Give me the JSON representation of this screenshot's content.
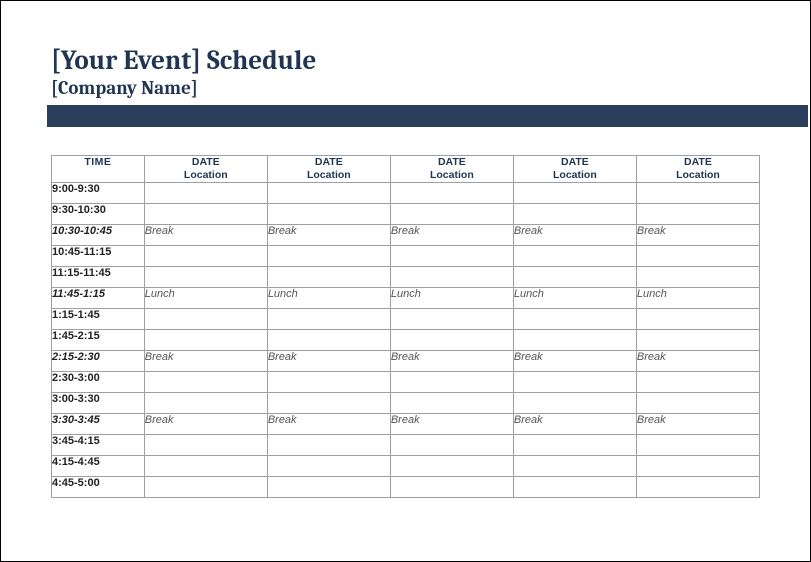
{
  "header": {
    "title": "[Your Event] Schedule",
    "subtitle": "[Company Name]"
  },
  "table": {
    "time_heading": "TIME",
    "column_header": {
      "date": "DATE",
      "location": "Location"
    },
    "columns": 5,
    "rows": [
      {
        "time": "9:00-9:30",
        "italic": false,
        "cells": [
          "",
          "",
          "",
          "",
          ""
        ]
      },
      {
        "time": "9:30-10:30",
        "italic": false,
        "cells": [
          "",
          "",
          "",
          "",
          ""
        ]
      },
      {
        "time": "10:30-10:45",
        "italic": true,
        "cells": [
          "Break",
          "Break",
          "Break",
          "Break",
          "Break"
        ]
      },
      {
        "time": "10:45-11:15",
        "italic": false,
        "cells": [
          "",
          "",
          "",
          "",
          ""
        ]
      },
      {
        "time": "11:15-11:45",
        "italic": false,
        "cells": [
          "",
          "",
          "",
          "",
          ""
        ]
      },
      {
        "time": "11:45-1:15",
        "italic": true,
        "cells": [
          "Lunch",
          "Lunch",
          "Lunch",
          "Lunch",
          "Lunch"
        ]
      },
      {
        "time": "1:15-1:45",
        "italic": false,
        "cells": [
          "",
          "",
          "",
          "",
          ""
        ]
      },
      {
        "time": "1:45-2:15",
        "italic": false,
        "cells": [
          "",
          "",
          "",
          "",
          ""
        ]
      },
      {
        "time": "2:15-2:30",
        "italic": true,
        "cells": [
          "Break",
          "Break",
          "Break",
          "Break",
          "Break"
        ]
      },
      {
        "time": "2:30-3:00",
        "italic": false,
        "cells": [
          "",
          "",
          "",
          "",
          ""
        ]
      },
      {
        "time": "3:00-3:30",
        "italic": false,
        "cells": [
          "",
          "",
          "",
          "",
          ""
        ]
      },
      {
        "time": "3:30-3:45",
        "italic": true,
        "cells": [
          "Break",
          "Break",
          "Break",
          "Break",
          "Break"
        ]
      },
      {
        "time": "3:45-4:15",
        "italic": false,
        "cells": [
          "",
          "",
          "",
          "",
          ""
        ]
      },
      {
        "time": "4:15-4:45",
        "italic": false,
        "cells": [
          "",
          "",
          "",
          "",
          ""
        ]
      },
      {
        "time": "4:45-5:00",
        "italic": false,
        "cells": [
          "",
          "",
          "",
          "",
          ""
        ]
      }
    ]
  }
}
